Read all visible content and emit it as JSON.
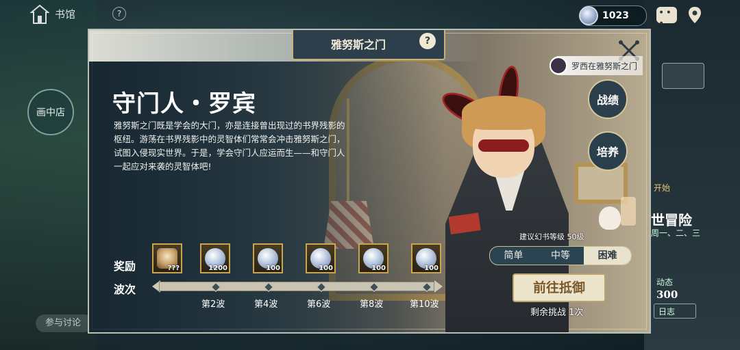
{
  "hud": {
    "home_label": "书馆",
    "help_mark": "?",
    "side_shop": "画中店",
    "discuss_placeholder": "参与讨论",
    "currency_amount": "1023"
  },
  "right_panel": {
    "ongoing": "开始",
    "adventure": "世冒险",
    "days": "周一、二、三",
    "dynamic_label": "动态",
    "dynamic_value": "300",
    "log_label": "日志"
  },
  "popup": {
    "title": "雅努斯之门",
    "help": "?",
    "boss_name": "守门人・罗宾",
    "description": "雅努斯之门既是学会的大门，亦是连接曾出现过的书界残影的枢纽。游荡在书界残影中的灵智体们常常会冲击雅努斯之门，试图入侵现实世界。于是，学会守门人应运而生——和守门人一起应对来袭的灵智体吧!",
    "reward_label": "奖励",
    "wave_label": "波次",
    "rewards": [
      {
        "count": "???",
        "icon": "special-item-icon"
      },
      {
        "count": "1200",
        "icon": "crystal-icon"
      },
      {
        "count": "100",
        "icon": "crystal-icon"
      },
      {
        "count": "100",
        "icon": "crystal-icon"
      },
      {
        "count": "100",
        "icon": "crystal-icon"
      },
      {
        "count": "100",
        "icon": "crystal-icon"
      }
    ],
    "waves": [
      "第2波",
      "第4波",
      "第6波",
      "第8波",
      "第10波"
    ],
    "ally_status": "罗西在雅努斯之门",
    "record_button": "战绩",
    "train_button": "培养",
    "recommend_level": "建议幻书等级 50级",
    "difficulty": {
      "options": [
        "简单",
        "中等",
        "困难"
      ],
      "selected": "困难"
    },
    "go_button": "前往抵御",
    "remaining": "剩余挑战 1次"
  },
  "colors": {
    "accent_gold": "#c9a54c",
    "panel_dark": "#2c4352",
    "button_cream": "#ece4cb",
    "mask_red": "#8c1d1f"
  }
}
